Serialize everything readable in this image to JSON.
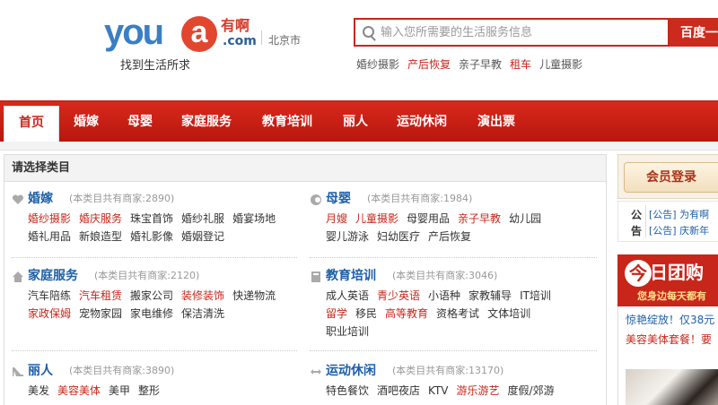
{
  "header": {
    "logo_text": "you",
    "logo_a": "a",
    "logo_cn": "有啊",
    "logo_com": ".com",
    "slogan": "找到生活所求",
    "city": "北京市",
    "search": {
      "placeholder": "输入您所需要的生活服务信息",
      "button_label": "百度一下"
    },
    "hot_links": [
      {
        "label": "婚纱摄影",
        "highlight": false
      },
      {
        "label": "产后恢复",
        "highlight": true
      },
      {
        "label": "亲子早教",
        "highlight": false
      },
      {
        "label": "租车",
        "highlight": true
      },
      {
        "label": "儿童摄影",
        "highlight": false
      }
    ]
  },
  "nav": {
    "items": [
      "首页",
      "婚嫁",
      "母婴",
      "家庭服务",
      "教育培训",
      "丽人",
      "运动休闲",
      "演出票"
    ],
    "active_index": 0
  },
  "categories": {
    "heading": "请选择类目",
    "list": [
      {
        "title": "婚嫁",
        "count": "(本类目共有商家:2890)",
        "icon": "heart-icon",
        "rows": [
          [
            {
              "t": "婚纱摄影",
              "r": true
            },
            {
              "t": "婚庆服务",
              "r": true
            },
            {
              "t": "珠宝首饰",
              "r": false
            },
            {
              "t": "婚纱礼服",
              "r": false
            },
            {
              "t": "婚宴场地",
              "r": false
            }
          ],
          [
            {
              "t": "婚礼用品",
              "r": false
            },
            {
              "t": "新娘造型",
              "r": false
            },
            {
              "t": "婚礼影像",
              "r": false
            },
            {
              "t": "婚姻登记",
              "r": false
            }
          ]
        ]
      },
      {
        "title": "母婴",
        "count": "(本类目共有商家:1984)",
        "icon": "baby-icon",
        "rows": [
          [
            {
              "t": "月嫂",
              "r": true
            },
            {
              "t": "儿童摄影",
              "r": true
            },
            {
              "t": "母婴用品",
              "r": false
            },
            {
              "t": "亲子早教",
              "r": true
            },
            {
              "t": "幼儿园",
              "r": false
            }
          ],
          [
            {
              "t": "婴儿游泳",
              "r": false
            },
            {
              "t": "妇幼医疗",
              "r": false
            },
            {
              "t": "产后恢复",
              "r": false
            }
          ]
        ]
      },
      {
        "title": "家庭服务",
        "count": "(本类目共有商家:2120)",
        "icon": "house-icon",
        "rows": [
          [
            {
              "t": "汽车陪练",
              "r": false
            },
            {
              "t": "汽车租赁",
              "r": true
            },
            {
              "t": "搬家公司",
              "r": false
            },
            {
              "t": "装修装饰",
              "r": true
            },
            {
              "t": "快递物流",
              "r": false
            }
          ],
          [
            {
              "t": "家政保姆",
              "r": true
            },
            {
              "t": "宠物家园",
              "r": false
            },
            {
              "t": "家电维修",
              "r": false
            },
            {
              "t": "保洁清洗",
              "r": false
            }
          ]
        ]
      },
      {
        "title": "教育培训",
        "count": "(本类目共有商家:3046)",
        "icon": "book-icon",
        "rows": [
          [
            {
              "t": "成人英语",
              "r": false
            },
            {
              "t": "青少英语",
              "r": true
            },
            {
              "t": "小语种",
              "r": false
            },
            {
              "t": "家教辅导",
              "r": false
            },
            {
              "t": "IT培训",
              "r": false
            }
          ],
          [
            {
              "t": "留学",
              "r": true
            },
            {
              "t": "移民",
              "r": false
            },
            {
              "t": "高等教育",
              "r": true
            },
            {
              "t": "资格考试",
              "r": false
            },
            {
              "t": "文体培训",
              "r": false
            }
          ],
          [
            {
              "t": "职业培训",
              "r": false
            }
          ]
        ]
      },
      {
        "title": "丽人",
        "count": "(本类目共有商家:3890)",
        "icon": "heel-icon",
        "rows": [
          [
            {
              "t": "美发",
              "r": false
            },
            {
              "t": "美容美体",
              "r": true
            },
            {
              "t": "美甲",
              "r": false
            },
            {
              "t": "整形",
              "r": false
            }
          ]
        ]
      },
      {
        "title": "运动休闲",
        "count": "(本类目共有商家:13170)",
        "icon": "arrows-icon",
        "rows": [
          [
            {
              "t": "特色餐饮",
              "r": false
            },
            {
              "t": "酒吧夜店",
              "r": false
            },
            {
              "t": "KTV",
              "r": false
            },
            {
              "t": "游乐游艺",
              "r": true
            },
            {
              "t": "度假/郊游",
              "r": false
            }
          ]
        ]
      }
    ]
  },
  "sidebar": {
    "login_label": "会员登录",
    "notice_label": "公告",
    "notices": [
      "[公告] 为有啊",
      "[公告] 庆新年"
    ],
    "group_logo": "今",
    "group_title": "日团购",
    "group_sub": "您身边每天都有",
    "group_lines": [
      {
        "text": "惊艳绽放！仅38元",
        "color": "#1d5fa8"
      },
      {
        "text": "美容美体套餐！要",
        "color": "#c8261a"
      }
    ]
  },
  "colors": {
    "brand_red": "#c8261a",
    "link_blue": "#1d5fa8",
    "logo_blue": "#3a7fc4"
  }
}
